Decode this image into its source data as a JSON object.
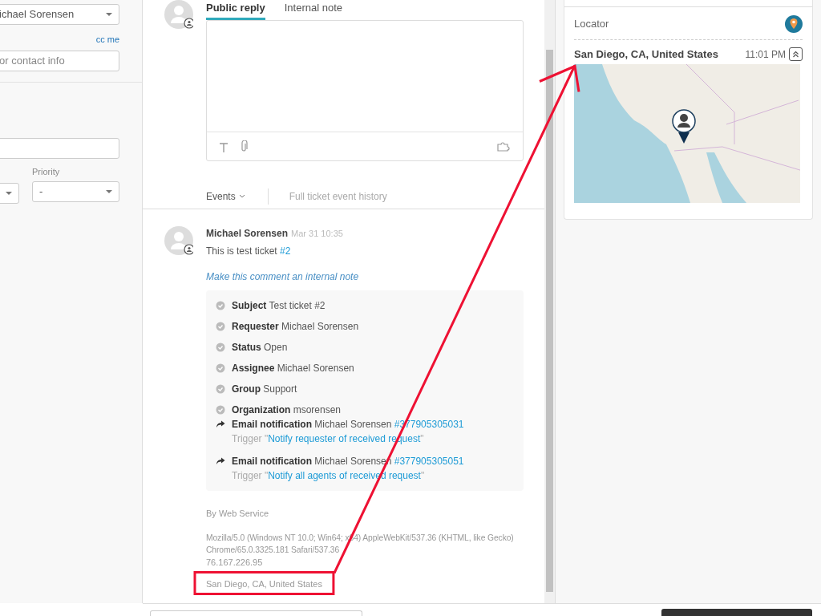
{
  "sidebar": {
    "requester_value": "ichael Sorensen",
    "cc_link": "cc me",
    "cc_placeholder": "or contact info",
    "priority_label": "Priority",
    "priority_value": "-"
  },
  "composer": {
    "tabs": [
      {
        "label": "Public reply",
        "selected": true
      },
      {
        "label": "Internal note",
        "selected": false
      }
    ]
  },
  "events_filter": "Events",
  "history_link": "Full ticket event history",
  "comment": {
    "author": "Michael Sorensen",
    "time": "Mar 31 10:35",
    "body": "This is test ticket",
    "body_link": "#2",
    "internal_note_link": "Make this comment an internal note",
    "events": [
      {
        "kind": "change",
        "field": "Subject",
        "value": "Test ticket #2"
      },
      {
        "kind": "change",
        "field": "Requester",
        "value": "Michael Sorensen"
      },
      {
        "kind": "change",
        "field": "Status",
        "value": "Open"
      },
      {
        "kind": "change",
        "field": "Assignee",
        "value": "Michael Sorensen"
      },
      {
        "kind": "change",
        "field": "Group",
        "value": "Support"
      },
      {
        "kind": "change",
        "field": "Organization",
        "value": "msorensen"
      },
      {
        "kind": "notification",
        "field": "Email notification",
        "value": "Michael Sorensen",
        "link": "#377905305031",
        "trigger_prefix": "Trigger \"",
        "trigger": "Notify requester of received request",
        "trigger_suffix": "\""
      },
      {
        "kind": "notification",
        "field": "Email notification",
        "value": "Michael Sorensen",
        "link": "#377905305051",
        "trigger_prefix": "Trigger \"",
        "trigger": "Notify all agents of received request",
        "trigger_suffix": "\""
      }
    ],
    "via": "By Web Service",
    "user_agent": "Mozilla/5.0 (Windows NT 10.0; Win64; x64) AppleWebKit/537.36 (KHTML, like Gecko) Chrome/65.0.3325.181 Safari/537.36",
    "ip": "76.167.226.95",
    "location": "San Diego, CA, United States"
  },
  "locator": {
    "title": "Locator",
    "location": "San Diego, CA, United States",
    "time": "11:01 PM"
  }
}
